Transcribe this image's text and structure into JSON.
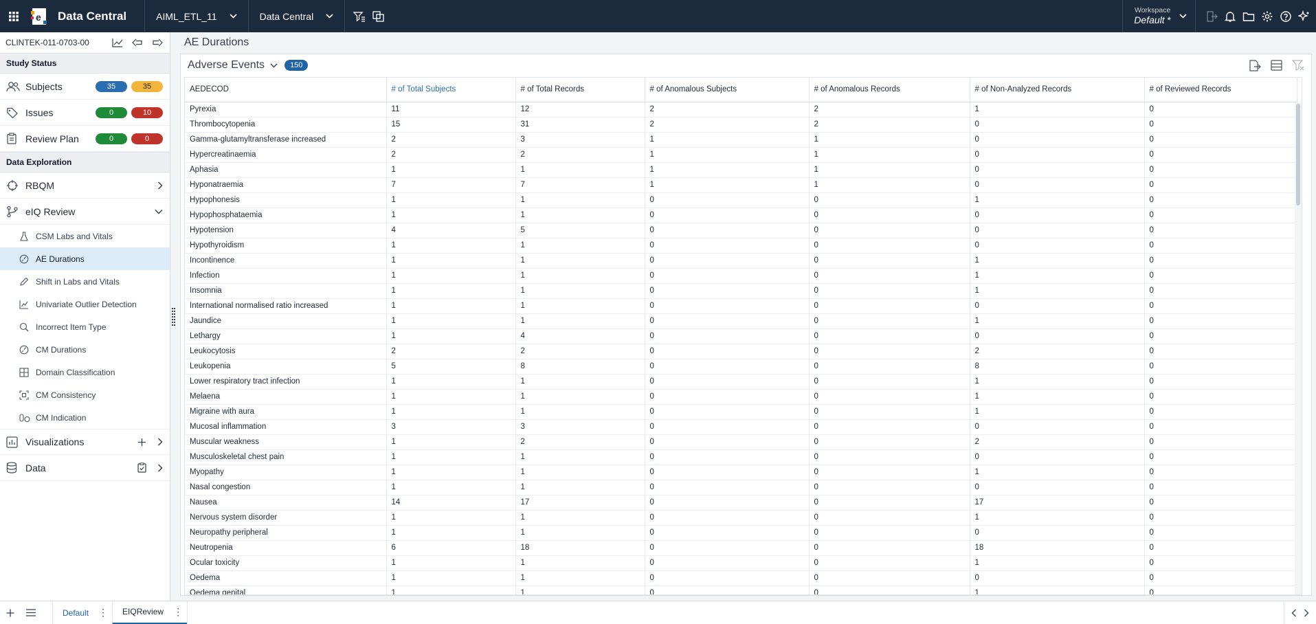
{
  "topbar": {
    "app_name": "Data Central",
    "study_dropdown": "AIML_ETL_11",
    "module_dropdown": "Data Central",
    "workspace_label": "Workspace",
    "workspace_value": "Default",
    "workspace_modified": "*"
  },
  "sidebar": {
    "study_id": "CLINTEK-011-0703-00",
    "study_status_header": "Study Status",
    "status_items": [
      {
        "label": "Subjects",
        "badge1": "35",
        "badge2": "35"
      },
      {
        "label": "Issues",
        "badge1": "0",
        "badge2": "10"
      },
      {
        "label": "Review Plan",
        "badge1": "0",
        "badge2": "0"
      }
    ],
    "data_exploration_header": "Data Exploration",
    "rbqm_label": "RBQM",
    "eiq_label": "eIQ Review",
    "sub_items": [
      "CSM Labs and Vitals",
      "AE Durations",
      "Shift in Labs and Vitals",
      "Univariate Outlier Detection",
      "Incorrect Item Type",
      "CM Durations",
      "Domain Classification",
      "CM Consistency",
      "CM Indication"
    ],
    "visualizations_label": "Visualizations",
    "data_label": "Data"
  },
  "main": {
    "page_title": "AE Durations",
    "card_title": "Adverse Events",
    "count": "150",
    "columns": [
      "AEDECOD",
      "# of Total Subjects",
      "# of Total Records",
      "# of Anomalous Subjects",
      "# of Anomalous Records",
      "# of Non-Analyzed Records",
      "# of Reviewed Records"
    ],
    "rows": [
      [
        "Pyrexia",
        "11",
        "12",
        "2",
        "2",
        "1",
        "0"
      ],
      [
        "Thrombocytopenia",
        "15",
        "31",
        "2",
        "2",
        "0",
        "0"
      ],
      [
        "Gamma-glutamyltransferase increased",
        "2",
        "3",
        "1",
        "1",
        "0",
        "0"
      ],
      [
        "Hypercreatinaemia",
        "2",
        "2",
        "1",
        "1",
        "0",
        "0"
      ],
      [
        "Aphasia",
        "1",
        "1",
        "1",
        "1",
        "0",
        "0"
      ],
      [
        "Hyponatraemia",
        "7",
        "7",
        "1",
        "1",
        "0",
        "0"
      ],
      [
        "Hypophonesis",
        "1",
        "1",
        "0",
        "0",
        "1",
        "0"
      ],
      [
        "Hypophosphataemia",
        "1",
        "1",
        "0",
        "0",
        "0",
        "0"
      ],
      [
        "Hypotension",
        "4",
        "5",
        "0",
        "0",
        "0",
        "0"
      ],
      [
        "Hypothyroidism",
        "1",
        "1",
        "0",
        "0",
        "0",
        "0"
      ],
      [
        "Incontinence",
        "1",
        "1",
        "0",
        "0",
        "1",
        "0"
      ],
      [
        "Infection",
        "1",
        "1",
        "0",
        "0",
        "1",
        "0"
      ],
      [
        "Insomnia",
        "1",
        "1",
        "0",
        "0",
        "1",
        "0"
      ],
      [
        "International normalised ratio increased",
        "1",
        "1",
        "0",
        "0",
        "0",
        "0"
      ],
      [
        "Jaundice",
        "1",
        "1",
        "0",
        "0",
        "1",
        "0"
      ],
      [
        "Lethargy",
        "1",
        "4",
        "0",
        "0",
        "0",
        "0"
      ],
      [
        "Leukocytosis",
        "2",
        "2",
        "0",
        "0",
        "2",
        "0"
      ],
      [
        "Leukopenia",
        "5",
        "8",
        "0",
        "0",
        "8",
        "0"
      ],
      [
        "Lower respiratory tract infection",
        "1",
        "1",
        "0",
        "0",
        "1",
        "0"
      ],
      [
        "Melaena",
        "1",
        "1",
        "0",
        "0",
        "1",
        "0"
      ],
      [
        "Migraine with aura",
        "1",
        "1",
        "0",
        "0",
        "1",
        "0"
      ],
      [
        "Mucosal inflammation",
        "3",
        "3",
        "0",
        "0",
        "0",
        "0"
      ],
      [
        "Muscular weakness",
        "1",
        "2",
        "0",
        "0",
        "2",
        "0"
      ],
      [
        "Musculoskeletal chest pain",
        "1",
        "1",
        "0",
        "0",
        "0",
        "0"
      ],
      [
        "Myopathy",
        "1",
        "1",
        "0",
        "0",
        "1",
        "0"
      ],
      [
        "Nasal congestion",
        "1",
        "1",
        "0",
        "0",
        "0",
        "0"
      ],
      [
        "Nausea",
        "14",
        "17",
        "0",
        "0",
        "17",
        "0"
      ],
      [
        "Nervous system disorder",
        "1",
        "1",
        "0",
        "0",
        "1",
        "0"
      ],
      [
        "Neuropathy peripheral",
        "1",
        "1",
        "0",
        "0",
        "0",
        "0"
      ],
      [
        "Neutropenia",
        "6",
        "18",
        "0",
        "0",
        "18",
        "0"
      ],
      [
        "Ocular toxicity",
        "1",
        "1",
        "0",
        "0",
        "1",
        "0"
      ],
      [
        "Oedema",
        "1",
        "1",
        "0",
        "0",
        "0",
        "0"
      ],
      [
        "Oedema genital",
        "1",
        "1",
        "0",
        "0",
        "1",
        "0"
      ]
    ]
  },
  "bottombar": {
    "tabs": [
      "Default",
      "EIQReview"
    ]
  },
  "colors": {
    "topbar_bg": "#1b2a3c",
    "accent_blue": "#1f64a7",
    "active_row": "#dcecf8",
    "badge_blue": "#2a6db0",
    "badge_yellow": "#f1b53b",
    "badge_green": "#1f8a37",
    "badge_red": "#c0332b"
  }
}
